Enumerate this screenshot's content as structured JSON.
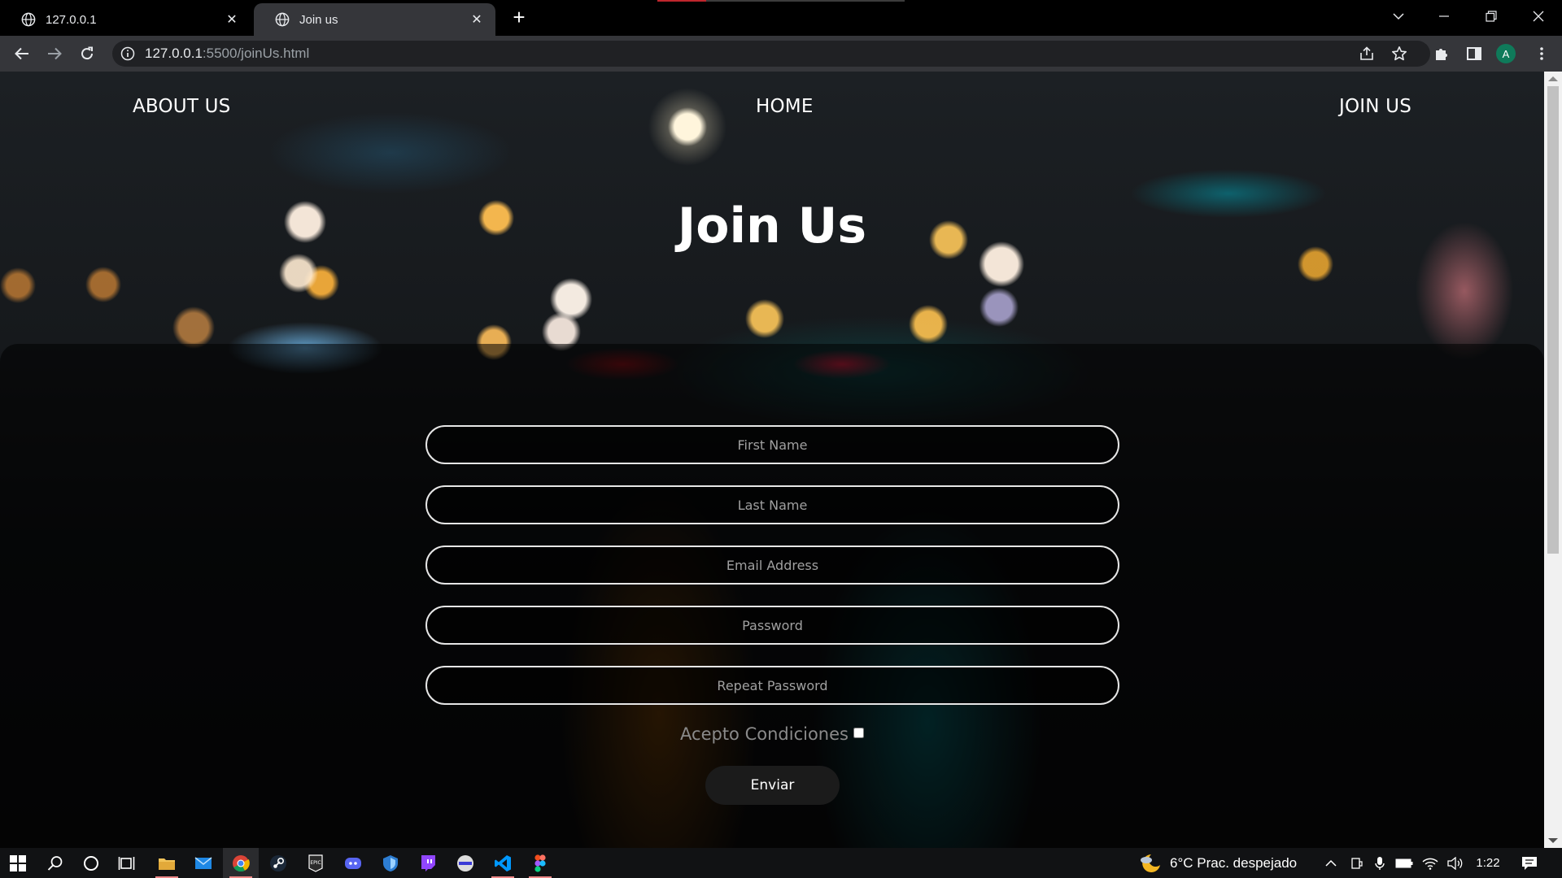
{
  "browser": {
    "tabs": [
      {
        "title": "127.0.0.1",
        "active": false
      },
      {
        "title": "Join us",
        "active": true
      }
    ],
    "url_host": "127.0.0.1",
    "url_path": ":5500/joinUs.html",
    "profile_initial": "A"
  },
  "nav": {
    "about": "ABOUT US",
    "home": "HOME",
    "join": "JOIN US"
  },
  "page": {
    "title": "Join Us"
  },
  "form": {
    "first_name_placeholder": "First Name",
    "last_name_placeholder": "Last Name",
    "email_placeholder": "Email Address",
    "password_placeholder": "Password",
    "repeat_password_placeholder": "Repeat Password",
    "terms_label": "Acepto Condiciones",
    "submit_label": "Enviar"
  },
  "taskbar": {
    "weather": "6°C  Prac. despejado",
    "time": "1:22"
  },
  "colors": {
    "tab_active": "#35363a",
    "panel_overlay": "rgba(0,0,0,0.55)",
    "field_border": "#e6e6e6",
    "submit_bg": "#1b1b1b"
  }
}
